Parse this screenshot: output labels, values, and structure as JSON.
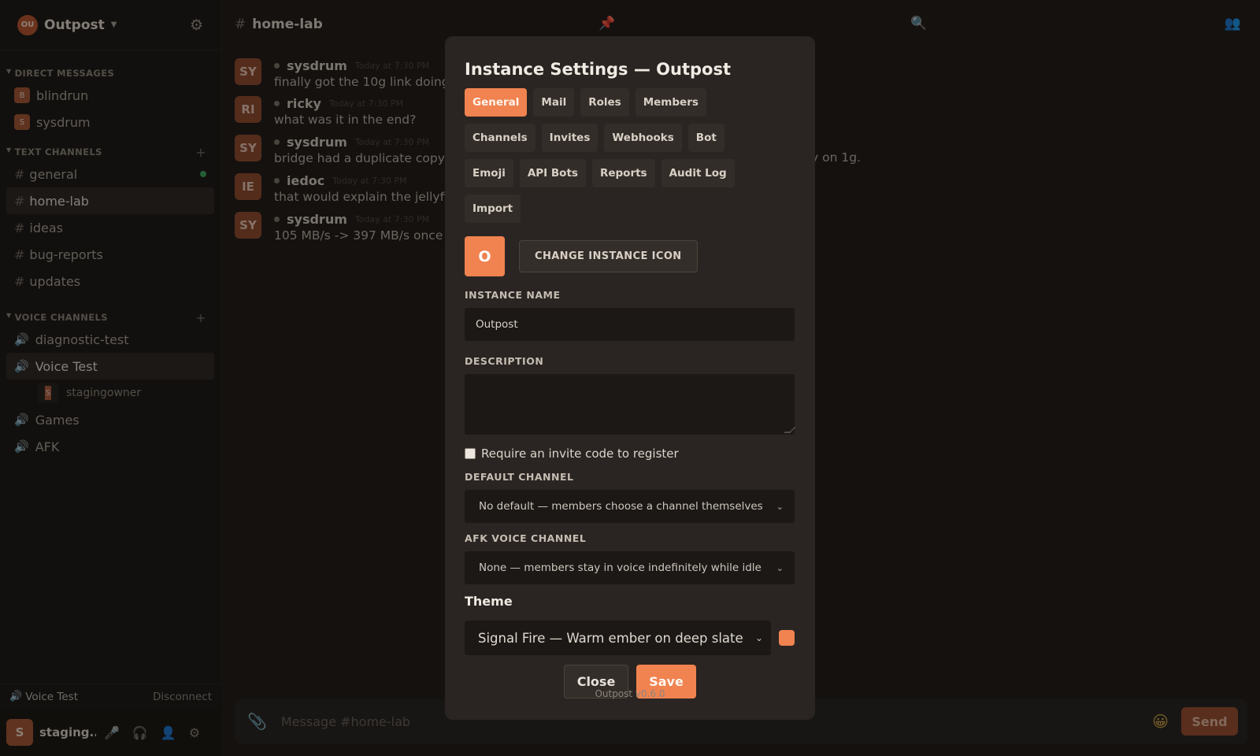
{
  "colors": {
    "accent": "#f08350",
    "online": "#3aa55d",
    "pin": "#c9473b"
  },
  "sidebar": {
    "instance_initials": "OU",
    "instance_name": "Outpost",
    "caret": "▼",
    "gear_glyph": "⚙",
    "dm_header": "DIRECT MESSAGES",
    "dms": [
      {
        "initial": "B",
        "name": "blindrun"
      },
      {
        "initial": "S",
        "name": "sysdrum"
      }
    ],
    "text_header": "TEXT CHANNELS",
    "text_channels": [
      "general",
      "home-lab",
      "ideas",
      "bug-reports",
      "updates"
    ],
    "voice_header": "VOICE CHANNELS",
    "voice_channels": [
      "diagnostic-test",
      "Voice Test",
      "Games",
      "AFK"
    ],
    "voice_member": {
      "initial": "S",
      "name": "stagingowner"
    },
    "plus": "+",
    "hash": "#",
    "tri": "▼",
    "speaker_glyph": "🔊"
  },
  "voice_bar": {
    "channel": "Voice Test",
    "disconnect": "Disconnect"
  },
  "user_bar": {
    "initial": "S",
    "name": "staging...",
    "mic_glyph": "🎤",
    "headphones_glyph": "🎧",
    "profile_glyph": "👤",
    "gear_glyph": "⚙"
  },
  "channel": {
    "hash": "#",
    "name": "home-lab",
    "pin_glyph": "📌",
    "search_glyph": "🔍",
    "members_glyph": "👥"
  },
  "messages": [
    {
      "initials": "SY",
      "author": "sysdrum",
      "time": "Today at 7:30 PM",
      "text": "finally got the 10g link doing"
    },
    {
      "initials": "RI",
      "author": "ricky",
      "time": "Today at 7:30 PM",
      "text": "what was it in the end?"
    },
    {
      "initials": "SY",
      "author": "sysdrum",
      "time": "Today at 7:30 PM",
      "text": "bridge had a duplicate copy c"
    },
    {
      "initials": "IE",
      "author": "iedoc",
      "time": "Today at 7:30 PM",
      "text": "that would explain the jellyfir"
    },
    {
      "initials": "SY",
      "author": "sysdrum",
      "time": "Today at 7:30 PM",
      "text": "105 MB/s -> 397 MB/s once it"
    }
  ],
  "message_tail": "y on 1g.",
  "composer": {
    "placeholder": "Message #home-lab",
    "clip_glyph": "📎",
    "emoji_glyph": "😀",
    "send": "Send"
  },
  "modal": {
    "title": "Instance Settings — Outpost",
    "tabs": [
      "General",
      "Mail",
      "Roles",
      "Members",
      "Channels",
      "Invites",
      "Webhooks",
      "Bot",
      "Emoji",
      "API Bots",
      "Reports",
      "Audit Log",
      "Import"
    ],
    "active_tab": "General",
    "icon_letter": "O",
    "change_icon": "CHANGE INSTANCE ICON",
    "name_label": "INSTANCE NAME",
    "name_value": "Outpost",
    "description_label": "DESCRIPTION",
    "description_value": "",
    "invite_checkbox": "Require an invite code to register",
    "invite_checked": false,
    "default_channel_label": "DEFAULT CHANNEL",
    "default_channel_value": "No default — members choose a channel themselves",
    "afk_label": "AFK VOICE CHANNEL",
    "afk_value": "None — members stay in voice indefinitely while idle",
    "theme_label": "Theme",
    "theme_value": "Signal Fire — Warm ember on deep slate",
    "close": "Close",
    "save": "Save",
    "version": "Outpost v0.6.0",
    "chevron": "⌄"
  }
}
